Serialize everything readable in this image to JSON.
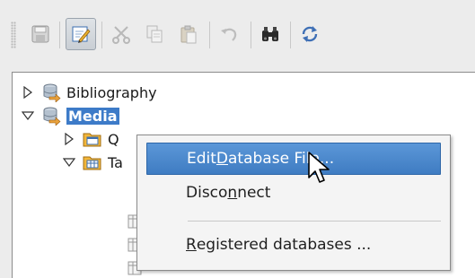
{
  "toolbar": {
    "buttons": [
      {
        "icon": "save-icon",
        "state": "disabled"
      },
      {
        "icon": "edit-icon",
        "state": "active"
      },
      {
        "icon": "cut-icon",
        "state": "disabled"
      },
      {
        "icon": "copy-icon",
        "state": "disabled"
      },
      {
        "icon": "paste-icon",
        "state": "disabled"
      },
      {
        "icon": "undo-icon",
        "state": "disabled"
      },
      {
        "icon": "find-icon",
        "state": "enabled"
      },
      {
        "icon": "refresh-icon",
        "state": "enabled"
      }
    ]
  },
  "tree": {
    "bibliography": {
      "label": "Bibliography",
      "expanded": false
    },
    "media": {
      "label": "Media",
      "expanded": true,
      "selected": true
    },
    "queries": {
      "label": "Q",
      "expanded": false
    },
    "tables": {
      "label": "Ta",
      "expanded": true
    }
  },
  "context_menu": {
    "items": [
      {
        "pre": "Edit ",
        "mnemonic": "D",
        "post": "atabase File...",
        "highlighted": true
      },
      {
        "pre": "Disco",
        "mnemonic": "n",
        "post": "nect",
        "highlighted": false
      },
      {
        "pre": "",
        "mnemonic": "R",
        "post": "egistered databases ...",
        "highlighted": false
      }
    ]
  },
  "colors": {
    "selection": "#3d7bc8",
    "menu_highlight": "#4a88cc",
    "toolbar_bg": "#ececec",
    "tree_bg": "#ffffff"
  }
}
